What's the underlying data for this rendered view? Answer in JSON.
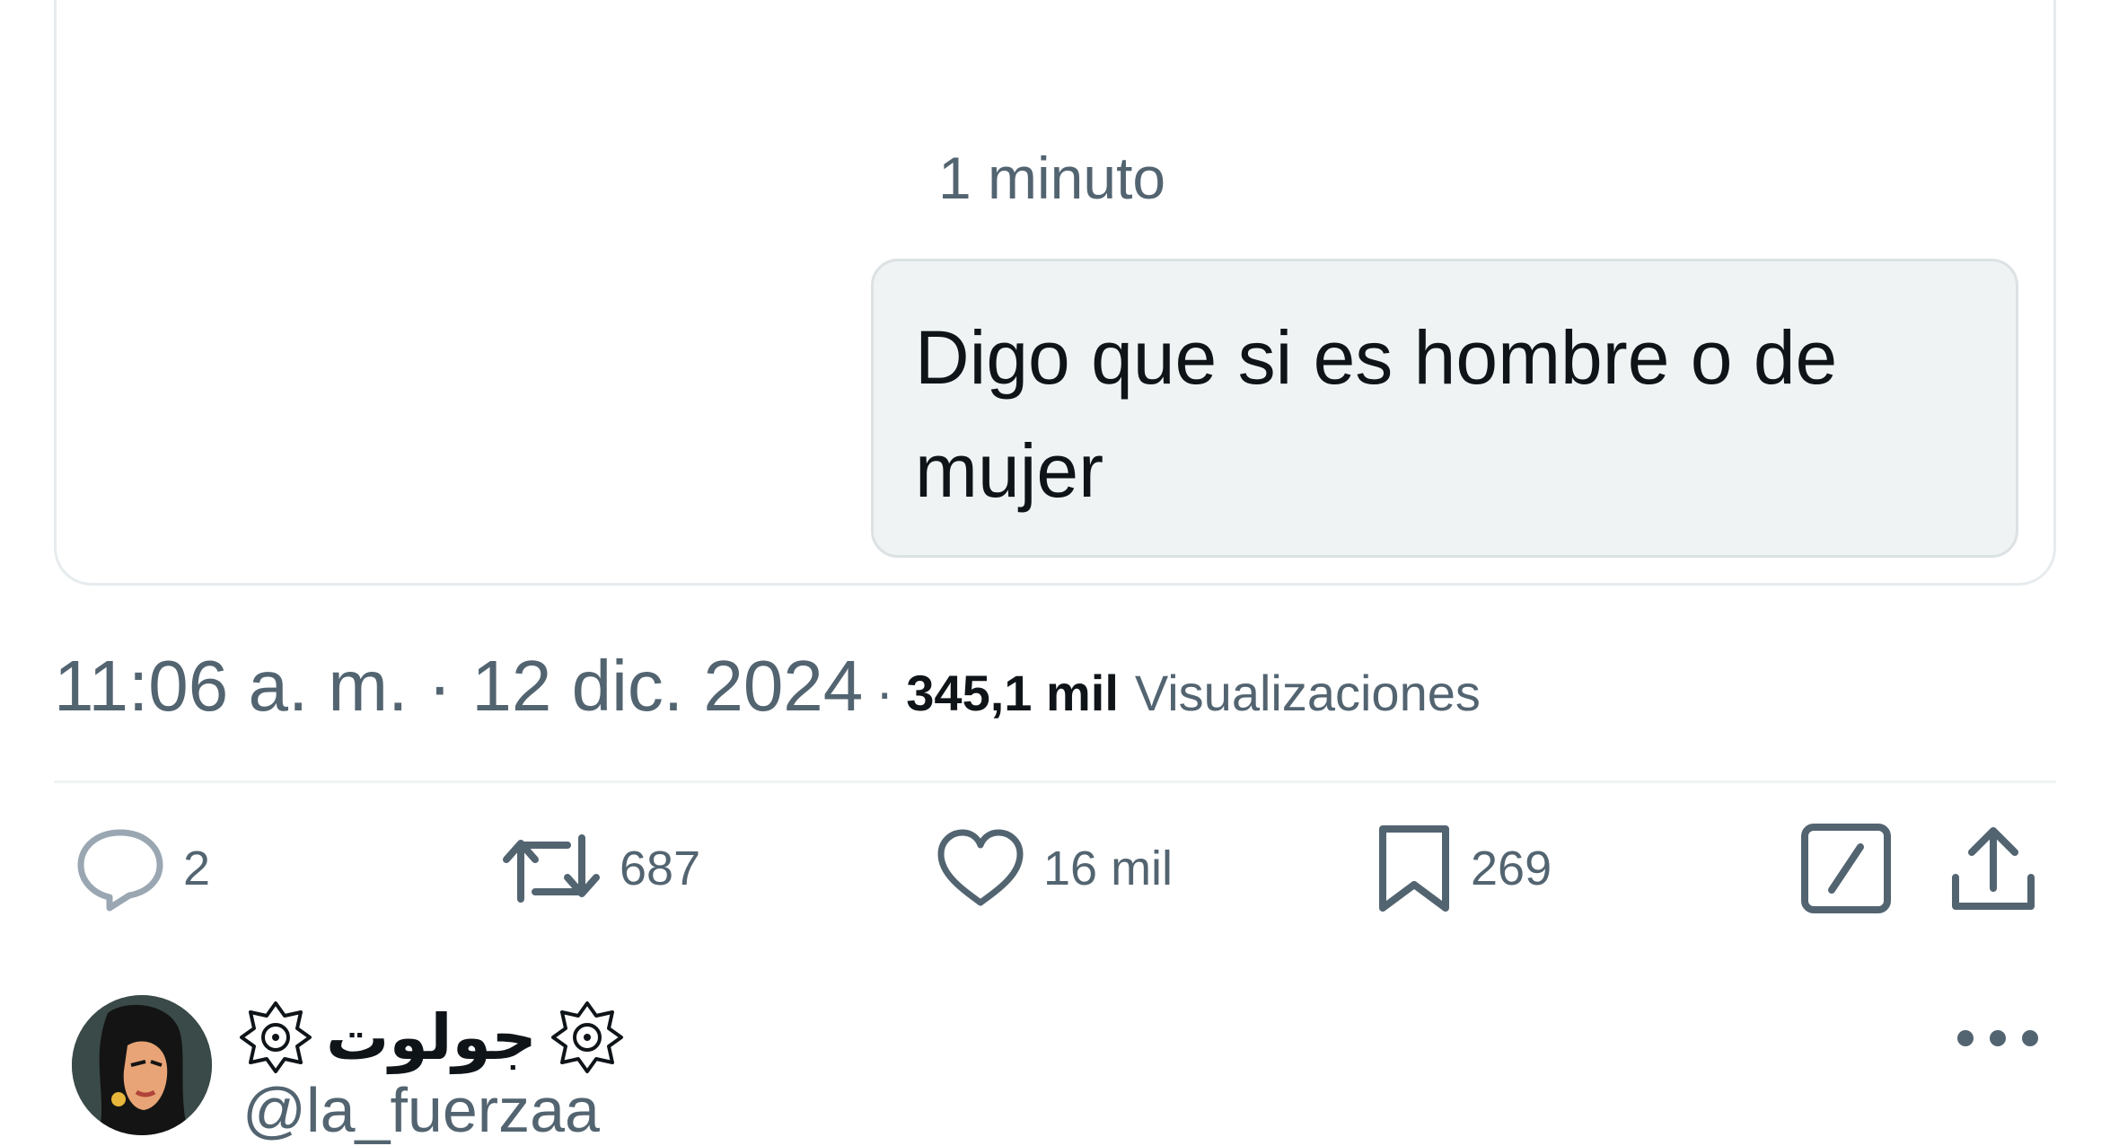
{
  "message": {
    "timestamp": "1 minuto",
    "text": "Digo que si es hombre o de mujer"
  },
  "post_meta": {
    "time": "11:06 a. m. · 12 dic. 2024",
    "separator": "·",
    "views_count": "345,1 mil",
    "views_label": "Visualizaciones"
  },
  "actions": {
    "replies": "2",
    "reposts": "687",
    "likes": "16 mil",
    "bookmarks": "269"
  },
  "reply": {
    "name": "جولوت",
    "handle": "@la_fuerzaa"
  },
  "colors": {
    "secondary_text": "#536471",
    "bubble_bg": "#eff3f4",
    "avatar_orange": "#ff7518"
  },
  "icons": [
    "reply-icon",
    "repost-icon",
    "like-icon",
    "bookmark-icon",
    "grok-icon",
    "share-icon",
    "more-icon",
    "gear-badge-icon"
  ]
}
